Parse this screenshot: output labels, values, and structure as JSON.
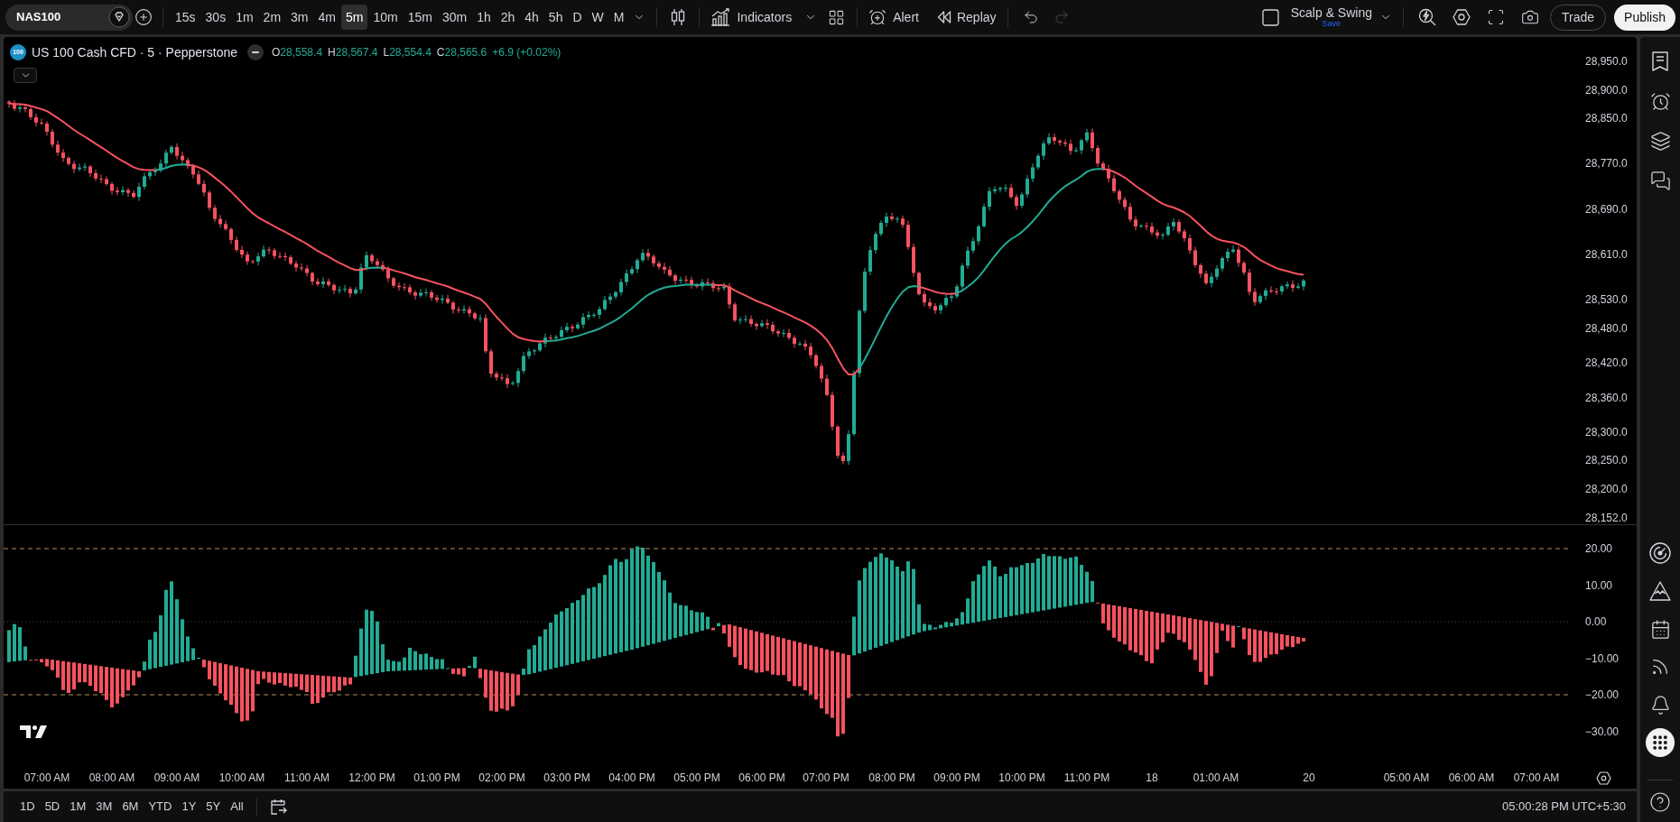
{
  "toolbar": {
    "symbol": "NAS100",
    "intervals": [
      {
        "label": "15s",
        "selected": false
      },
      {
        "label": "30s",
        "selected": false
      },
      {
        "label": "1m",
        "selected": false
      },
      {
        "label": "2m",
        "selected": false
      },
      {
        "label": "3m",
        "selected": false
      },
      {
        "label": "4m",
        "selected": false
      },
      {
        "label": "5m",
        "selected": true
      },
      {
        "label": "10m",
        "selected": false
      },
      {
        "label": "15m",
        "selected": false
      },
      {
        "label": "30m",
        "selected": false
      },
      {
        "label": "1h",
        "selected": false
      },
      {
        "label": "2h",
        "selected": false
      },
      {
        "label": "4h",
        "selected": false
      },
      {
        "label": "5h",
        "selected": false
      },
      {
        "label": "D",
        "selected": false
      },
      {
        "label": "W",
        "selected": false
      },
      {
        "label": "M",
        "selected": false
      }
    ],
    "indicators_label": "Indicators",
    "alert_label": "Alert",
    "replay_label": "Replay",
    "undo": {
      "disabled": false
    },
    "redo": {
      "disabled": true
    },
    "layout": {
      "name": "Scalp & Swing",
      "status": "Save"
    },
    "trade_label": "Trade",
    "publish_label": "Publish"
  },
  "legend": {
    "logo": "100",
    "title": "US 100 Cash CFD · 5 · Pepperstone",
    "ohlc": [
      {
        "key": "O",
        "value": "28,558.4"
      },
      {
        "key": "H",
        "value": "28,567.4"
      },
      {
        "key": "L",
        "value": "28,554.4"
      },
      {
        "key": "C",
        "value": "28,565.6"
      }
    ],
    "change": "+6.9 (+0.02%)"
  },
  "price_axis": {
    "labels": [
      "28,950.0",
      "28,900.0",
      "28,850.0",
      "28,770.0",
      "28,690.0",
      "28,610.0",
      "28,530.0",
      "28,480.0",
      "28,420.0",
      "28,360.0",
      "28,300.0",
      "28,250.0",
      "28,200.0",
      "28,152.0"
    ]
  },
  "indicator_axis": {
    "labels": [
      "20.00",
      "10.00",
      "0.00",
      "−10.00",
      "−20.00",
      "−30.00"
    ]
  },
  "time_axis": {
    "labels": [
      "07:00 AM",
      "08:00 AM",
      "09:00 AM",
      "10:00 AM",
      "11:00 AM",
      "12:00 PM",
      "01:00 PM",
      "02:00 PM",
      "03:00 PM",
      "04:00 PM",
      "05:00 PM",
      "06:00 PM",
      "07:00 PM",
      "08:00 PM",
      "09:00 PM",
      "10:00 PM",
      "11:00 PM",
      "18",
      "01:00 AM",
      "20",
      "05:00 AM",
      "06:00 AM",
      "07:00 AM"
    ]
  },
  "range_bar": {
    "ranges": [
      "1D",
      "5D",
      "1M",
      "3M",
      "6M",
      "YTD",
      "1Y",
      "5Y",
      "All"
    ],
    "clock": "05:00:28 PM UTC+5:30"
  }
}
